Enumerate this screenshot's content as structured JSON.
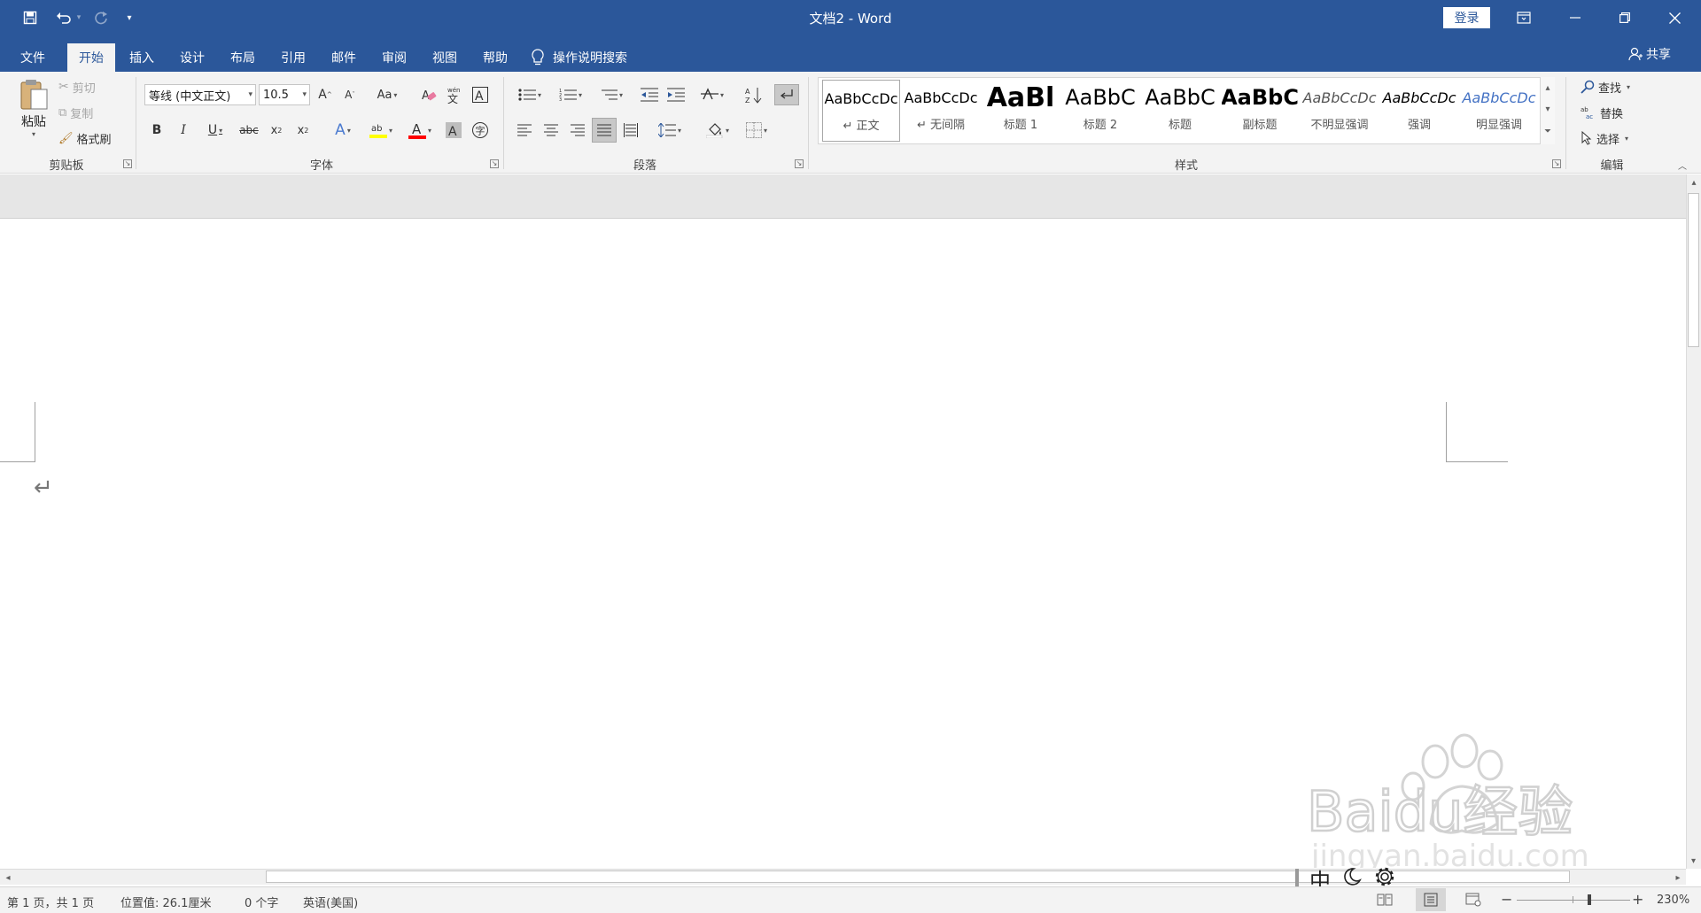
{
  "titlebar": {
    "title": "文档2  -  Word",
    "login": "登录",
    "save_icon": "save-icon",
    "undo_icon": "undo-icon",
    "redo_icon": "redo-icon",
    "customize_icon": "customize-qat-icon"
  },
  "tabs": [
    {
      "label": "文件"
    },
    {
      "label": "开始"
    },
    {
      "label": "插入"
    },
    {
      "label": "设计"
    },
    {
      "label": "布局"
    },
    {
      "label": "引用"
    },
    {
      "label": "邮件"
    },
    {
      "label": "审阅"
    },
    {
      "label": "视图"
    },
    {
      "label": "帮助"
    }
  ],
  "tell_me": "操作说明搜索",
  "share": "共享",
  "clipboard": {
    "paste": "粘贴",
    "cut": "剪切",
    "copy": "复制",
    "format_painter": "格式刷",
    "group": "剪贴板"
  },
  "font": {
    "name": "等线 (中文正文)",
    "size": "10.5",
    "change_case": "Aa",
    "group": "字体"
  },
  "paragraph": {
    "group": "段落"
  },
  "styles": {
    "items": [
      {
        "sample": "AaBbCcDc",
        "name": "↵ 正文"
      },
      {
        "sample": "AaBbCcDc",
        "name": "↵ 无间隔"
      },
      {
        "sample": "AaBl",
        "name": "标题 1"
      },
      {
        "sample": "AaBbC",
        "name": "标题 2"
      },
      {
        "sample": "AaBbC",
        "name": "标题"
      },
      {
        "sample": "AaBbC",
        "name": "副标题"
      },
      {
        "sample": "AaBbCcDc",
        "name": "不明显强调"
      },
      {
        "sample": "AaBbCcDc",
        "name": "强调"
      },
      {
        "sample": "AaBbCcDc",
        "name": "明显强调"
      }
    ],
    "group": "样式"
  },
  "editing": {
    "find": "查找",
    "replace": "替换",
    "select": "选择",
    "group": "编辑"
  },
  "document": {
    "paragraph_mark": "↵"
  },
  "ime": {
    "mode": "中"
  },
  "status": {
    "page": "第 1 页，共 1 页",
    "position": "位置值: 26.1厘米",
    "words": "0 个字",
    "language": "英语(美国)",
    "zoom": "230%",
    "zoom_minus": "−",
    "zoom_plus": "+"
  },
  "watermark": {
    "brand": "Baidu经验",
    "url": "jingyan.baidu.com"
  },
  "colors": {
    "accent": "#2b579a",
    "ribbon": "#f3f3f3",
    "highlight": "#ffff00",
    "font_color": "#ff0000"
  }
}
